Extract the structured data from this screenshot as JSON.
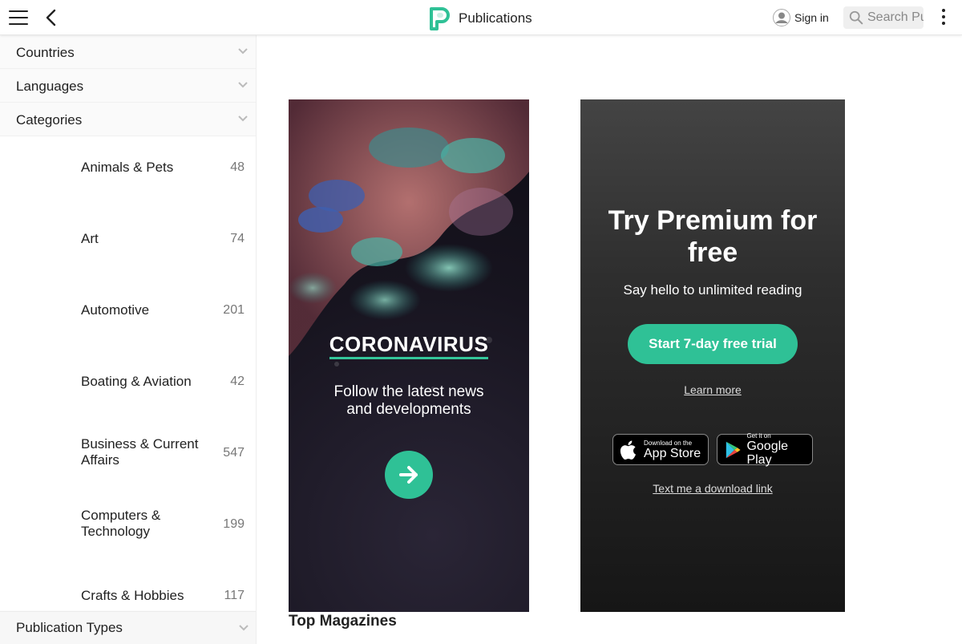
{
  "header": {
    "title": "Publications",
    "signin_label": "Sign in",
    "search_placeholder": "Search Publications",
    "brand_color": "#2fc196"
  },
  "sidebar": {
    "sections": [
      {
        "label": "Countries"
      },
      {
        "label": "Languages"
      },
      {
        "label": "Categories"
      }
    ],
    "categories": [
      {
        "name": "Animals & Pets",
        "count": "48"
      },
      {
        "name": "Art",
        "count": "74"
      },
      {
        "name": "Automotive",
        "count": "201"
      },
      {
        "name": "Boating & Aviation",
        "count": "42"
      },
      {
        "name": "Business & Current Affairs",
        "count": "547"
      },
      {
        "name": "Computers & Technology",
        "count": "199"
      },
      {
        "name": "Crafts & Hobbies",
        "count": "117"
      }
    ],
    "publication_types_label": "Publication Types"
  },
  "covid_banner": {
    "title": "CORONAVIRUS",
    "subtitle": "Follow the latest news and developments",
    "icon": "arrow-right-icon"
  },
  "premium_banner": {
    "title": "Try Premium for free",
    "subtitle": "Say hello to unlimited reading",
    "cta": "Start 7-day free trial",
    "learn_more": "Learn more",
    "app_store_small": "Download on the",
    "app_store_big": "App Store",
    "google_play_small": "Get it on",
    "google_play_big": "Google Play",
    "text_link": "Text me a download link"
  },
  "main": {
    "section_title": "Top Magazines"
  }
}
